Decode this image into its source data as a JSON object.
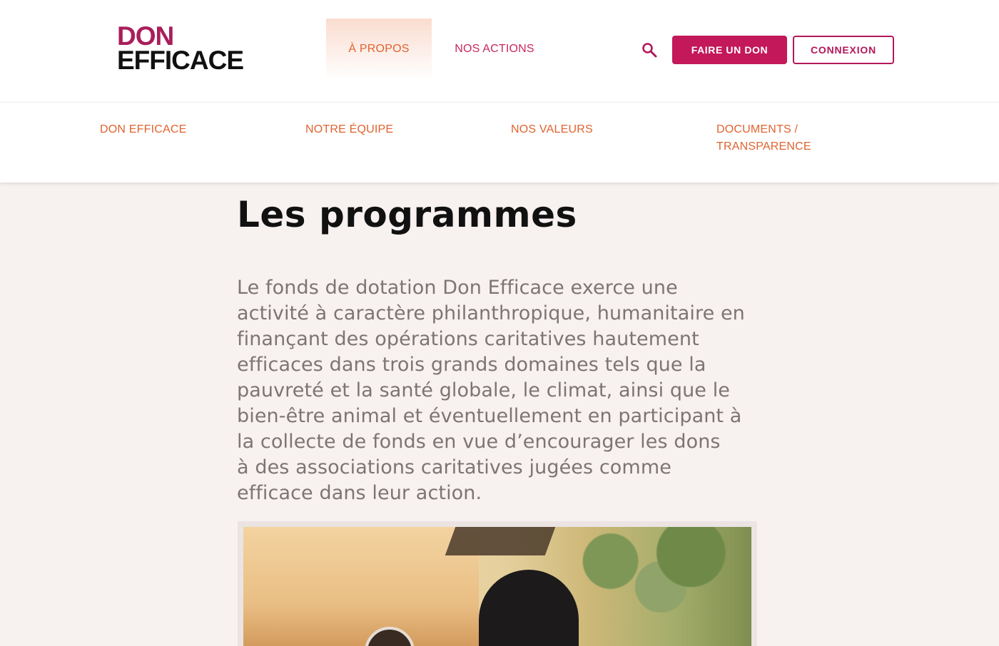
{
  "header": {
    "logo_line1": "DON",
    "logo_line2": "EFFICACE",
    "nav": [
      {
        "label": "À PROPOS",
        "active": true
      },
      {
        "label": "NOS ACTIONS",
        "active": false
      }
    ],
    "search_icon": "search-icon",
    "donate_label": "FAIRE UN DON",
    "login_label": "CONNEXION"
  },
  "subnav": {
    "items": [
      {
        "line1": "DON EFFICACE",
        "line2": ""
      },
      {
        "line1": "NOTRE ÉQUIPE",
        "line2": ""
      },
      {
        "line1": "NOS VALEURS",
        "line2": ""
      },
      {
        "line1": "DOCUMENTS /",
        "line2": "TRANSPARENCE"
      }
    ]
  },
  "main": {
    "title": "Les programmes",
    "intro_lines": [
      "Le fonds de dotation Don Efficace exerce une",
      "activité à caractère philanthropique, humanitaire en",
      "finançant des opérations caritatives hautement",
      "efficaces dans trois grands domaines tels que la",
      "pauvreté et la santé globale, le climat, ainsi que le",
      "bien-être animal et éventuellement en participant à",
      "la collecte de fonds en vue d’encourager les dons",
      "à des associations caritatives jugées comme",
      "efficace dans leur action."
    ]
  },
  "colors": {
    "accent_orange": "#e0632f",
    "brand_magenta": "#c3185a",
    "page_background": "#f7f1f0"
  }
}
